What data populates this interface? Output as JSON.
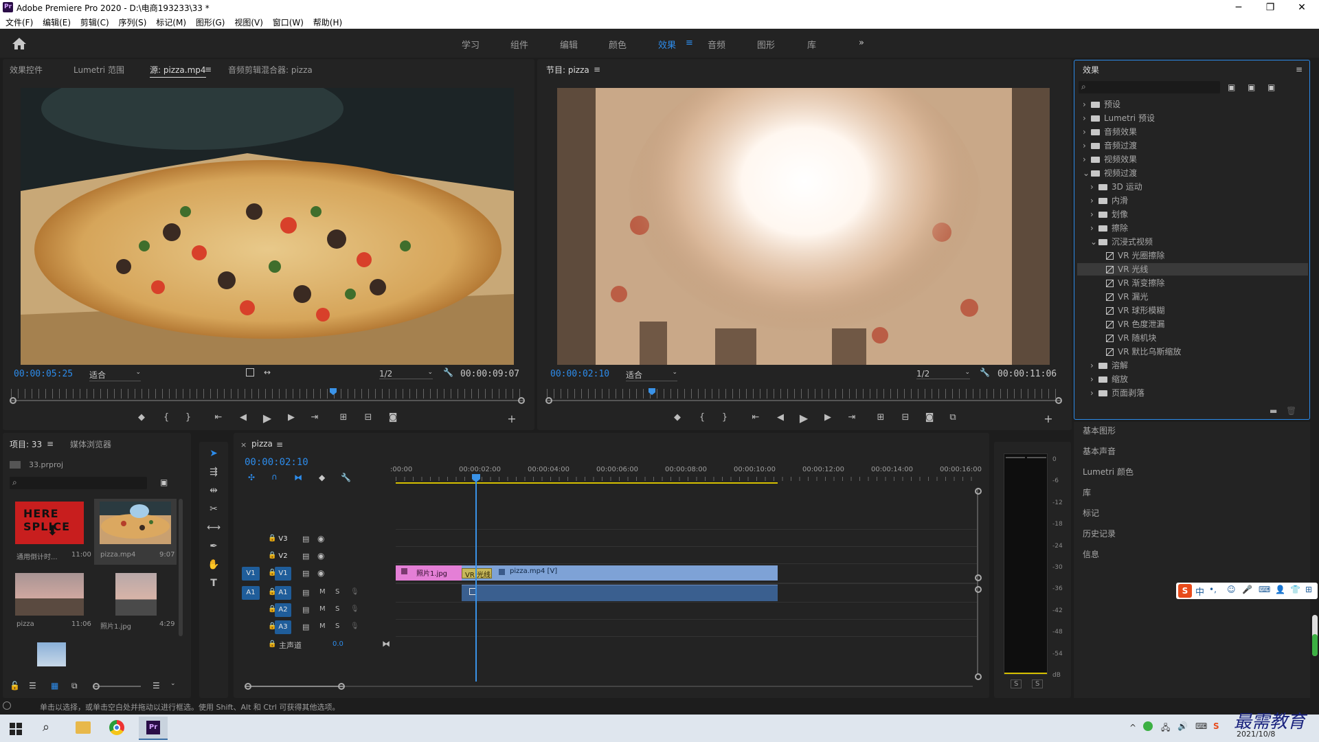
{
  "titlebar": {
    "app_icon": "Pr",
    "title": "Adobe Premiere Pro 2020 - D:\\电商193233\\33 *"
  },
  "menu": [
    "文件(F)",
    "编辑(E)",
    "剪辑(C)",
    "序列(S)",
    "标记(M)",
    "图形(G)",
    "视图(V)",
    "窗口(W)",
    "帮助(H)"
  ],
  "workspace": {
    "tabs": [
      "学习",
      "组件",
      "编辑",
      "颜色",
      "效果",
      "音频",
      "图形",
      "库"
    ],
    "active": "效果",
    "more": "»"
  },
  "source": {
    "tabs": [
      "效果控件",
      "Lumetri 范围",
      "源: pizza.mp4",
      "音频剪辑混合器: pizza"
    ],
    "active_tab": 2,
    "timecode": "00:00:05:25",
    "fit": "适合",
    "resolution": "1/2",
    "duration": "00:00:09:07"
  },
  "program": {
    "tab": "节目: pizza",
    "timecode": "00:00:02:10",
    "fit": "适合",
    "resolution": "1/2",
    "duration": "00:00:11:06"
  },
  "effects": {
    "title": "效果",
    "tree": [
      {
        "label": "预设",
        "type": "folder",
        "level": 0,
        "open": false
      },
      {
        "label": "Lumetri 预设",
        "type": "folder",
        "level": 0,
        "open": false
      },
      {
        "label": "音频效果",
        "type": "folder",
        "level": 0,
        "open": false
      },
      {
        "label": "音频过渡",
        "type": "folder",
        "level": 0,
        "open": false
      },
      {
        "label": "视频效果",
        "type": "folder",
        "level": 0,
        "open": false
      },
      {
        "label": "视频过渡",
        "type": "folder",
        "level": 0,
        "open": true
      },
      {
        "label": "3D 运动",
        "type": "folder",
        "level": 1,
        "open": false
      },
      {
        "label": "内滑",
        "type": "folder",
        "level": 1,
        "open": false
      },
      {
        "label": "划像",
        "type": "folder",
        "level": 1,
        "open": false
      },
      {
        "label": "擦除",
        "type": "folder",
        "level": 1,
        "open": false
      },
      {
        "label": "沉浸式视频",
        "type": "folder",
        "level": 1,
        "open": true
      },
      {
        "label": "VR 光圈擦除",
        "type": "fx",
        "level": 2
      },
      {
        "label": "VR 光线",
        "type": "fx",
        "level": 2,
        "selected": true
      },
      {
        "label": "VR 渐变擦除",
        "type": "fx",
        "level": 2
      },
      {
        "label": "VR 漏光",
        "type": "fx",
        "level": 2
      },
      {
        "label": "VR 球形模糊",
        "type": "fx",
        "level": 2
      },
      {
        "label": "VR 色度泄漏",
        "type": "fx",
        "level": 2
      },
      {
        "label": "VR 随机块",
        "type": "fx",
        "level": 2
      },
      {
        "label": "VR 默比乌斯缩放",
        "type": "fx",
        "level": 2
      },
      {
        "label": "溶解",
        "type": "folder",
        "level": 1,
        "open": false
      },
      {
        "label": "缩放",
        "type": "folder",
        "level": 1,
        "open": false
      },
      {
        "label": "页面剥落",
        "type": "folder",
        "level": 1,
        "open": false
      }
    ],
    "sections": [
      "基本图形",
      "基本声音",
      "Lumetri 颜色",
      "库",
      "标记",
      "历史记录",
      "信息"
    ]
  },
  "project": {
    "tabs": [
      "项目: 33",
      "媒体浏览器"
    ],
    "file": "33.prproj",
    "items": [
      {
        "name": "通用倒计时...",
        "duration": "11:00",
        "thumb_text": "HERE SPLICE"
      },
      {
        "name": "pizza.mp4",
        "duration": "9:07"
      },
      {
        "name": "pizza",
        "duration": "11:06"
      },
      {
        "name": "照片1.jpg",
        "duration": "4:29"
      }
    ]
  },
  "timeline": {
    "tab": "pizza",
    "timecode": "00:00:02:10",
    "ruler": [
      ":00:00",
      "00:00:02:00",
      "00:00:04:00",
      "00:00:06:00",
      "00:00:08:00",
      "00:00:10:00",
      "00:00:12:00",
      "00:00:14:00",
      "00:00:16:00"
    ],
    "video_tracks": [
      "V3",
      "V2",
      "V1"
    ],
    "audio_tracks": [
      "A1",
      "A2",
      "A3"
    ],
    "source_v": "V1",
    "source_a": "A1",
    "mute": "M",
    "solo": "S",
    "master": {
      "label": "主声道",
      "value": "0.0"
    },
    "clips": {
      "photo": "照片1.jpg",
      "transition": "VR 光线",
      "video": "pizza.mp4 [V]"
    }
  },
  "vu": {
    "scale": [
      "0",
      "-6",
      "-12",
      "-18",
      "-24",
      "-30",
      "-36",
      "-42",
      "-48",
      "-54",
      "dB"
    ],
    "solo": [
      "S",
      "S"
    ]
  },
  "status": "单击以选择，或单击空白处并拖动以进行框选。使用 Shift、Alt 和 Ctrl 可获得其他选项。",
  "taskbar": {
    "date": "2021/10/8",
    "watermark": "最需教育",
    "ime": "中"
  },
  "colors": {
    "accent": "#2d8ceb",
    "clip_photo": "#e47fd6",
    "clip_video": "#7ea2d6",
    "audio_clip": "#3a5f8f",
    "playhead": "#3a93e8"
  }
}
